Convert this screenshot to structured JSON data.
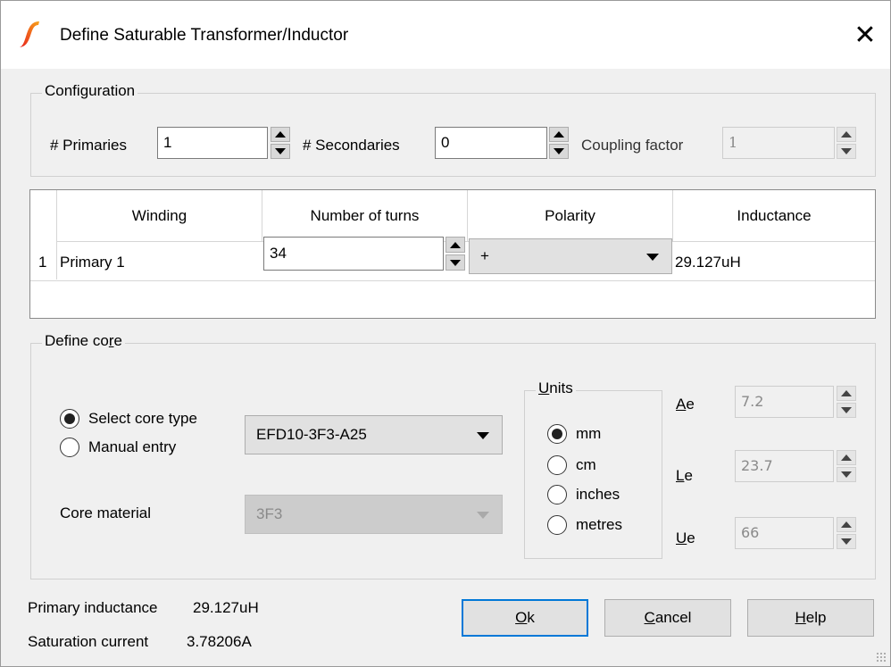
{
  "window": {
    "title": "Define Saturable Transformer/Inductor",
    "close_glyph": "✕",
    "app_icon": "simetrix-logo-icon"
  },
  "configuration": {
    "label_pre": "Confi",
    "label_mn": "g",
    "label_post": "uration",
    "primaries_label": "# Primaries",
    "primaries_value": "1",
    "secondaries_label": "# Secondaries",
    "secondaries_value": "0",
    "coupling_label": "Coupling factor",
    "coupling_value": "1"
  },
  "windings_table": {
    "columns": [
      "Winding",
      "Number of turns",
      "Polarity",
      "Inductance"
    ],
    "rows": [
      {
        "index": "1",
        "winding": "Primary 1",
        "turns": "34",
        "polarity": "+",
        "inductance": "29.127uH"
      }
    ]
  },
  "core": {
    "label_pre": "Define co",
    "label_mn": "r",
    "label_post": "e",
    "select_core_type_label": "Select core type",
    "manual_entry_label": "Manual entry",
    "selected_mode": "select",
    "core_type_value": "EFD10-3F3-A25",
    "core_material_label": "Core material",
    "core_material_value": "3F3",
    "units": {
      "label_mn": "U",
      "label_post": "nits",
      "options": [
        "mm",
        "cm",
        "inches",
        "metres"
      ],
      "selected": "mm"
    },
    "ae": {
      "mn": "A",
      "rest": "e",
      "value": "7.2"
    },
    "le": {
      "mn": "L",
      "rest": "e",
      "value": "23.7"
    },
    "ue": {
      "mn": "U",
      "rest": "e",
      "value": "66"
    }
  },
  "summary": {
    "primary_inductance_label": "Primary inductance",
    "primary_inductance_value": "29.127uH",
    "saturation_current_label": "Saturation current",
    "saturation_current_value": "3.78206A"
  },
  "buttons": {
    "ok": {
      "mn": "O",
      "rest": "k"
    },
    "cancel": {
      "mn": "C",
      "rest": "ancel"
    },
    "help": {
      "mn": "H",
      "rest": "elp"
    }
  },
  "colors": {
    "accent": "#0078d7",
    "logo_red": "#e8201c",
    "logo_orange": "#f7a31c"
  }
}
